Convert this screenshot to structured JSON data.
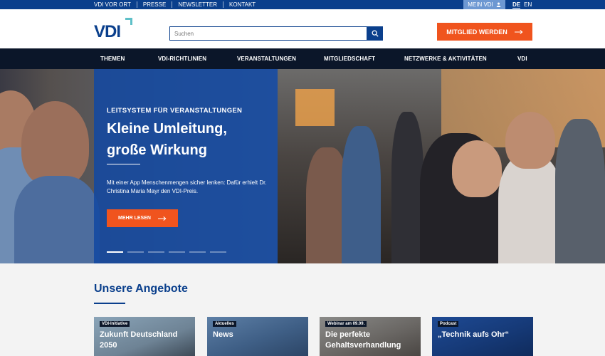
{
  "topbar": {
    "links": [
      "VDI VOR ORT",
      "PRESSE",
      "NEWSLETTER",
      "KONTAKT"
    ],
    "account_label": "MEIN VDI",
    "languages": [
      "DE",
      "EN"
    ]
  },
  "header": {
    "logo_text": "VDI",
    "search_placeholder": "Suchen",
    "cta_label": "MITGLIED WERDEN"
  },
  "nav": {
    "items": [
      "THEMEN",
      "VDI-RICHTLINIEN",
      "VERANSTALTUNGEN",
      "MITGLIEDSCHAFT",
      "NETZWERKE & AKTIVITÄTEN",
      "VDI"
    ]
  },
  "hero": {
    "kicker": "LEITSYSTEM FÜR VERANSTALTUNGEN",
    "title": "Kleine Umleitung, große Wirkung",
    "description": "Mit einer App Menschenmengen sicher lenken: Dafür erhielt Dr. Christina Maria Mayr den VDI-Preis.",
    "button_label": "MEHR LESEN",
    "slides_total": 6,
    "active_slide": 1
  },
  "offers": {
    "title": "Unsere Angebote",
    "cards": [
      {
        "badge": "VDI-Initiative",
        "title": "Zukunft Deutschland 2050"
      },
      {
        "badge": "Aktuelles",
        "title": "News"
      },
      {
        "badge": "Webinar am 09.09.",
        "title": "Die perfekte Gehaltsverhandlung"
      },
      {
        "badge": "Podcast",
        "title": "„Technik aufs Ohr“"
      }
    ]
  },
  "colors": {
    "brand_blue": "#0a3f8c",
    "accent_orange": "#f0541e",
    "nav_dark": "#0b1629"
  }
}
